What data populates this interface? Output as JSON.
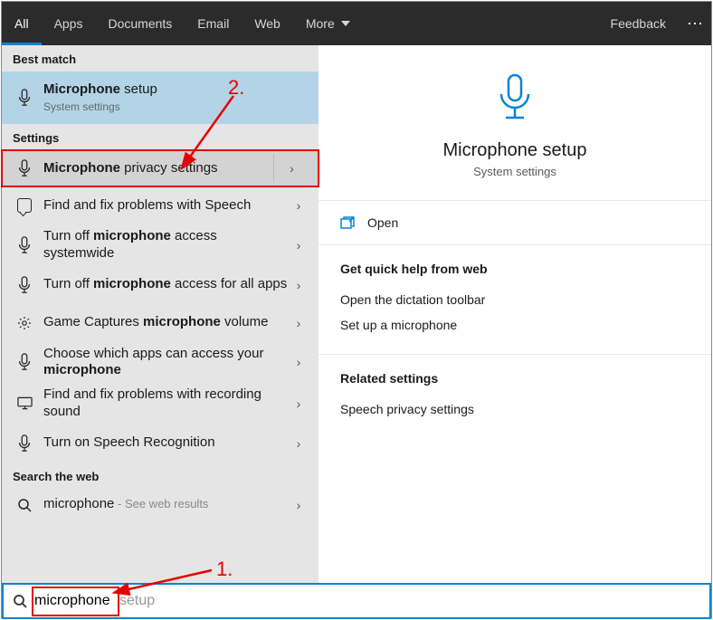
{
  "tabs": {
    "all": "All",
    "apps": "Apps",
    "documents": "Documents",
    "email": "Email",
    "web": "Web",
    "more": "More"
  },
  "feedback": "Feedback",
  "sections": {
    "bestmatch": "Best match",
    "settings": "Settings",
    "searchweb": "Search the web"
  },
  "bestmatch": {
    "title_pre": "Microphone",
    "title_post": " setup",
    "sub": "System settings"
  },
  "settings_items": [
    {
      "prefix": "Microphone",
      "suffix": " privacy settings",
      "icon": "mic"
    },
    {
      "text": "Find and fix problems with Speech",
      "icon": "speech"
    },
    {
      "prefix_plain": "Turn off ",
      "mid": "microphone",
      "suffix": " access systemwide",
      "icon": "mic"
    },
    {
      "prefix_plain": "Turn off ",
      "mid": "microphone",
      "suffix": " access for all apps",
      "icon": "mic"
    },
    {
      "prefix_plain": "Game Captures ",
      "mid": "microphone",
      "suffix": " volume",
      "icon": "gear"
    },
    {
      "prefix_plain": "Choose which apps can access your ",
      "mid": "microphone",
      "icon": "mic"
    },
    {
      "text": "Find and fix problems with recording sound",
      "icon": "monitor"
    },
    {
      "text": "Turn on Speech Recognition",
      "icon": "mic"
    }
  ],
  "websearch": {
    "term": "microphone",
    "hint": " - See web results"
  },
  "preview": {
    "title": "Microphone setup",
    "sub": "System settings",
    "open": "Open"
  },
  "help": {
    "head": "Get quick help from web",
    "items": [
      "Open the dictation toolbar",
      "Set up a microphone"
    ]
  },
  "related": {
    "head": "Related settings",
    "items": [
      "Speech privacy settings"
    ]
  },
  "search": {
    "value": "microphone",
    "placeholder": "setup"
  },
  "annotations": {
    "label1": "1.",
    "label2": "2."
  }
}
